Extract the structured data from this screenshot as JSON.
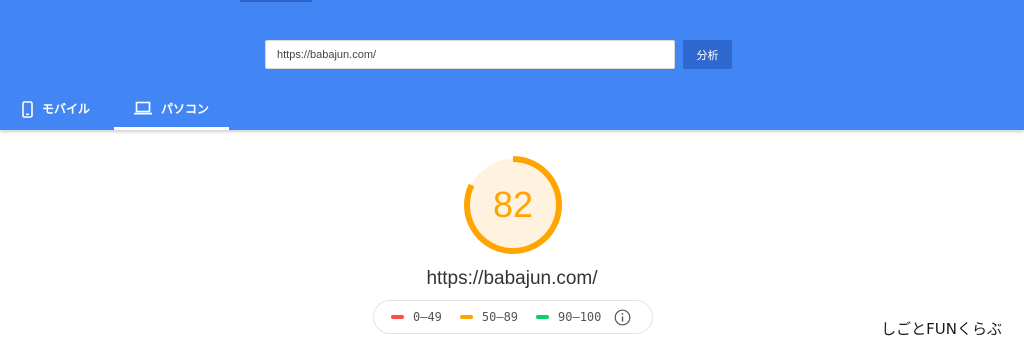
{
  "search": {
    "url_value": "https://babajun.com/",
    "analyze_label": "分析"
  },
  "tabs": [
    {
      "label": "モバイル",
      "icon": "smartphone-icon",
      "selected": false
    },
    {
      "label": "パソコン",
      "icon": "laptop-icon",
      "selected": true
    }
  ],
  "result": {
    "score": "82",
    "score_fraction": 0.82,
    "score_color": "#ffa400",
    "score_bg": "#fff3e0",
    "url": "https://babajun.com/"
  },
  "legend": [
    {
      "range": "0–49",
      "color": "#ff4e42"
    },
    {
      "range": "50–89",
      "color": "#ffa400"
    },
    {
      "range": "90–100",
      "color": "#0cce6b"
    }
  ],
  "colors": {
    "header": "#4285f4",
    "button": "#2f68cf"
  },
  "watermark": "しごとFUNくらぶ"
}
